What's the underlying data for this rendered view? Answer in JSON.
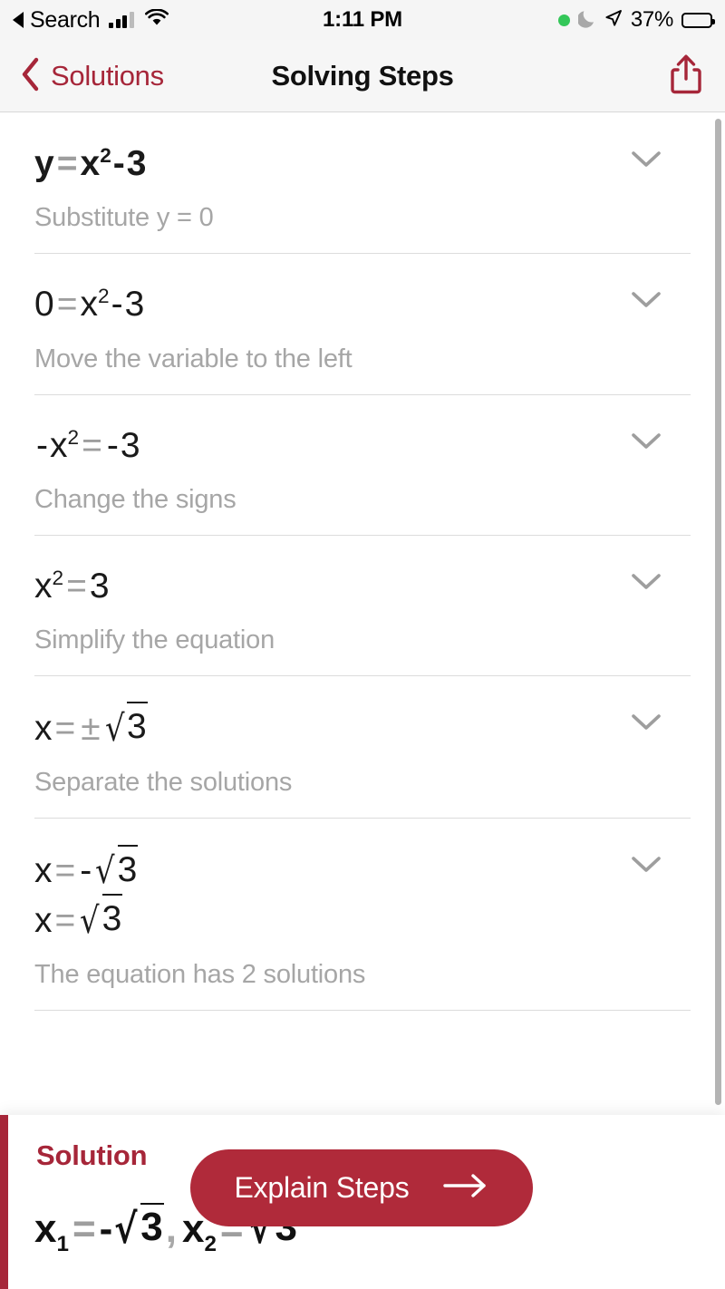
{
  "status_bar": {
    "carrier_back_label": "Search",
    "time": "1:11 PM",
    "battery_percent": "37%",
    "battery_level": 37,
    "icons": [
      "back-triangle-icon",
      "cellular-signal-icon",
      "wifi-icon",
      "green-recording-dot-icon",
      "do-not-disturb-moon-icon",
      "location-arrow-icon",
      "battery-icon"
    ]
  },
  "nav_bar": {
    "back_label": "Solutions",
    "title": "Solving Steps",
    "share_icon": "share-icon",
    "accent_color": "#A62639"
  },
  "steps": [
    {
      "equation_parts": {
        "lhs": "y",
        "op": "=",
        "base": "x",
        "exp": "2",
        "sign": "-",
        "rhs": "3"
      },
      "equation_text": "y = x2 - 3",
      "description": "Substitute y = 0",
      "bold": true,
      "chevron": "chevron-down-icon"
    },
    {
      "equation_parts": {
        "lhs": "0",
        "op": "=",
        "base": "x",
        "exp": "2",
        "sign": "-",
        "rhs": "3"
      },
      "equation_text": "0 = x2 - 3",
      "description": "Move the variable to the left",
      "bold": false,
      "chevron": "chevron-down-icon"
    },
    {
      "equation_parts": {
        "lhs": "-x",
        "op": "=",
        "base": "x",
        "exp": "2",
        "sign": "-",
        "rhs": "3"
      },
      "equation_text": "-x2 = -3",
      "description": "Change the signs",
      "bold": false,
      "chevron": "chevron-down-icon"
    },
    {
      "equation_parts": {
        "lhs": "x",
        "op": "=",
        "exp": "2",
        "rhs": "3"
      },
      "equation_text": "x2 = 3",
      "description": "Simplify the equation",
      "bold": false,
      "chevron": "chevron-down-icon"
    },
    {
      "equation_text": "x = ±√3",
      "description": "Separate the solutions",
      "bold": false,
      "chevron": "chevron-down-icon"
    },
    {
      "equation_text": "x = -√3",
      "equation_text_2": "x = √3",
      "description": "The equation has 2 solutions",
      "bold": false,
      "chevron": "chevron-down-icon"
    }
  ],
  "tokens": {
    "y": "y",
    "zero": "0",
    "x": "x",
    "exp2": "2",
    "three": "3",
    "equals": "=",
    "minus": "-",
    "plusminus": "±",
    "neg_x": "-x",
    "sub1": "1",
    "sub2": "2",
    "comma": ","
  },
  "solution": {
    "label": "Solution",
    "answer_text": "x1 = -√3 , x2 = √3",
    "accent_color": "#A62639"
  },
  "explain_button": {
    "label": "Explain Steps",
    "arrow_icon": "arrow-right-icon",
    "color": "#B02A3A"
  },
  "scrollbar": {
    "name": "vertical-scrollbar"
  }
}
